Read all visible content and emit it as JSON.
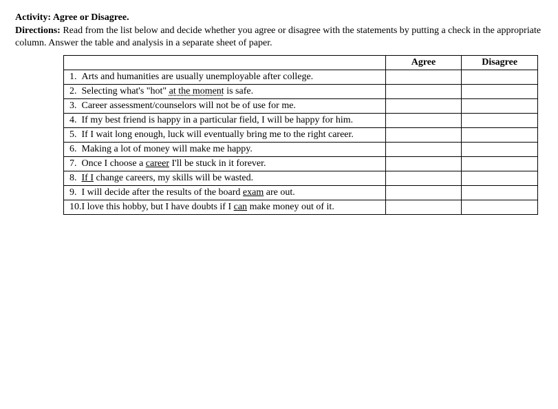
{
  "activity_label": "Activity: Agree or Disagree.",
  "directions_label": "Directions:",
  "directions_text": " Read from the list below and decide whether you agree or disagree with the statements by putting a check in the appropriate column. Answer the table and analysis in a separate sheet of paper.",
  "headers": {
    "agree": "Agree",
    "disagree": "Disagree"
  },
  "rows": [
    {
      "num": "1.",
      "pre": "Arts and humanities are usually unemployable after college.",
      "dotted": "",
      "post": ""
    },
    {
      "num": "2.",
      "pre": "Selecting what's \"hot\" ",
      "dotted": "at the moment",
      "post": " is safe."
    },
    {
      "num": "3.",
      "pre": "Career assessment/counselors will not be of use for me.",
      "dotted": "",
      "post": ""
    },
    {
      "num": "4.",
      "pre": "If my best friend is happy in a particular field, I will be happy for him.",
      "dotted": "",
      "post": ""
    },
    {
      "num": "5.",
      "pre": "If I wait long enough, luck will eventually bring me to the right career.",
      "dotted": "",
      "post": ""
    },
    {
      "num": "6.",
      "pre": "Making a lot of money will make me happy.",
      "dotted": "",
      "post": ""
    },
    {
      "num": "7.",
      "pre": "Once I choose a ",
      "solid": "career",
      "post": " I'll be stuck in it forever."
    },
    {
      "num": "8.",
      "solid_pre": "If I",
      "pre2": " change careers, my skills will be wasted."
    },
    {
      "num": "9.",
      "pre": "I will decide after the results of the board ",
      "solid": "exam",
      "post": " are out."
    },
    {
      "num": "10.",
      "pre": "I love this hobby, but I have doubts if I ",
      "solid": "can",
      "post": " make money out of it."
    }
  ]
}
